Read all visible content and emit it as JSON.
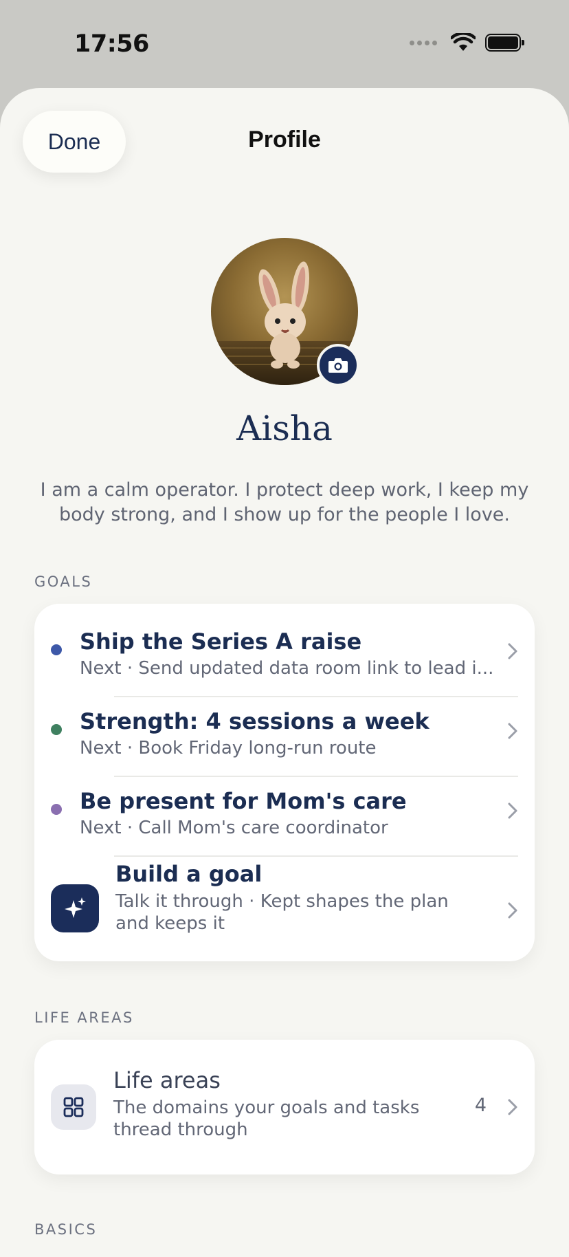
{
  "status_bar": {
    "time": "17:56"
  },
  "header": {
    "done_label": "Done",
    "title": "Profile"
  },
  "profile": {
    "name": "Aisha",
    "bio": "I am a calm operator. I protect deep work, I keep my body strong, and I show up for the people I love."
  },
  "goals_section": {
    "label": "GOALS",
    "items": [
      {
        "title": "Ship the Series A raise",
        "next": "Next · Send updated data room link to lead i...",
        "color": "#3d58a8"
      },
      {
        "title": "Strength: 4 sessions a week",
        "next": "Next · Book Friday long-run route",
        "color": "#3f8060"
      },
      {
        "title": "Be present for Mom's care",
        "next": "Next · Call Mom's care coordinator",
        "color": "#8a6fb0"
      }
    ],
    "build": {
      "title": "Build a goal",
      "subtitle_line1": "Talk it through · Kept shapes the plan",
      "subtitle_line2": "and keeps it",
      "icon": "sparkles-icon"
    }
  },
  "life_areas_section": {
    "label": "LIFE AREAS",
    "title": "Life areas",
    "subtitle_line1": "The domains your goals and tasks",
    "subtitle_line2": "thread through",
    "count": "4",
    "icon": "grid-icon"
  },
  "basics_section": {
    "label": "BASICS"
  }
}
